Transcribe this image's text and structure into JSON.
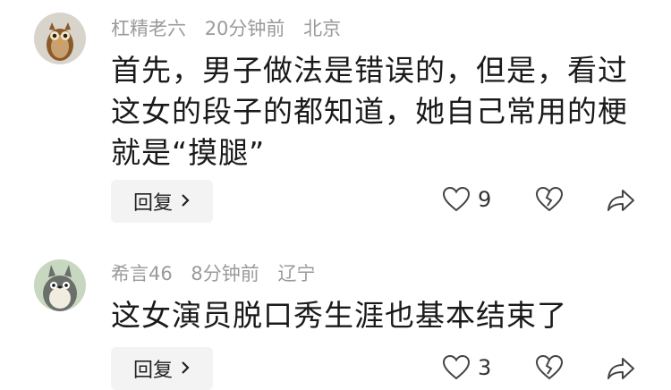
{
  "comments": [
    {
      "username": "杠精老六",
      "time": "20分钟前",
      "location": "北京",
      "text_lines": [
        "首先，男子做法是错误的，但是，看过",
        "这女的段子的都知道，她自己常用的梗",
        "就是“摸腿”"
      ],
      "reply_label": "回复",
      "likes": "9",
      "avatar": "owl-avatar"
    },
    {
      "username": "希言46",
      "time": "8分钟前",
      "location": "辽宁",
      "text_lines": [
        "这女演员脱口秀生涯也基本结束了"
      ],
      "reply_label": "回复",
      "likes": "3",
      "avatar": "totoro-avatar"
    }
  ],
  "icons": {
    "like": "heart-icon",
    "dislike": "broken-heart-icon",
    "share": "share-icon",
    "reply_chevron": "chevron-right-icon"
  },
  "colors": {
    "meta": "#9a9a9a",
    "text": "#1a1a1a",
    "reply_bg": "#f3f3f3"
  }
}
